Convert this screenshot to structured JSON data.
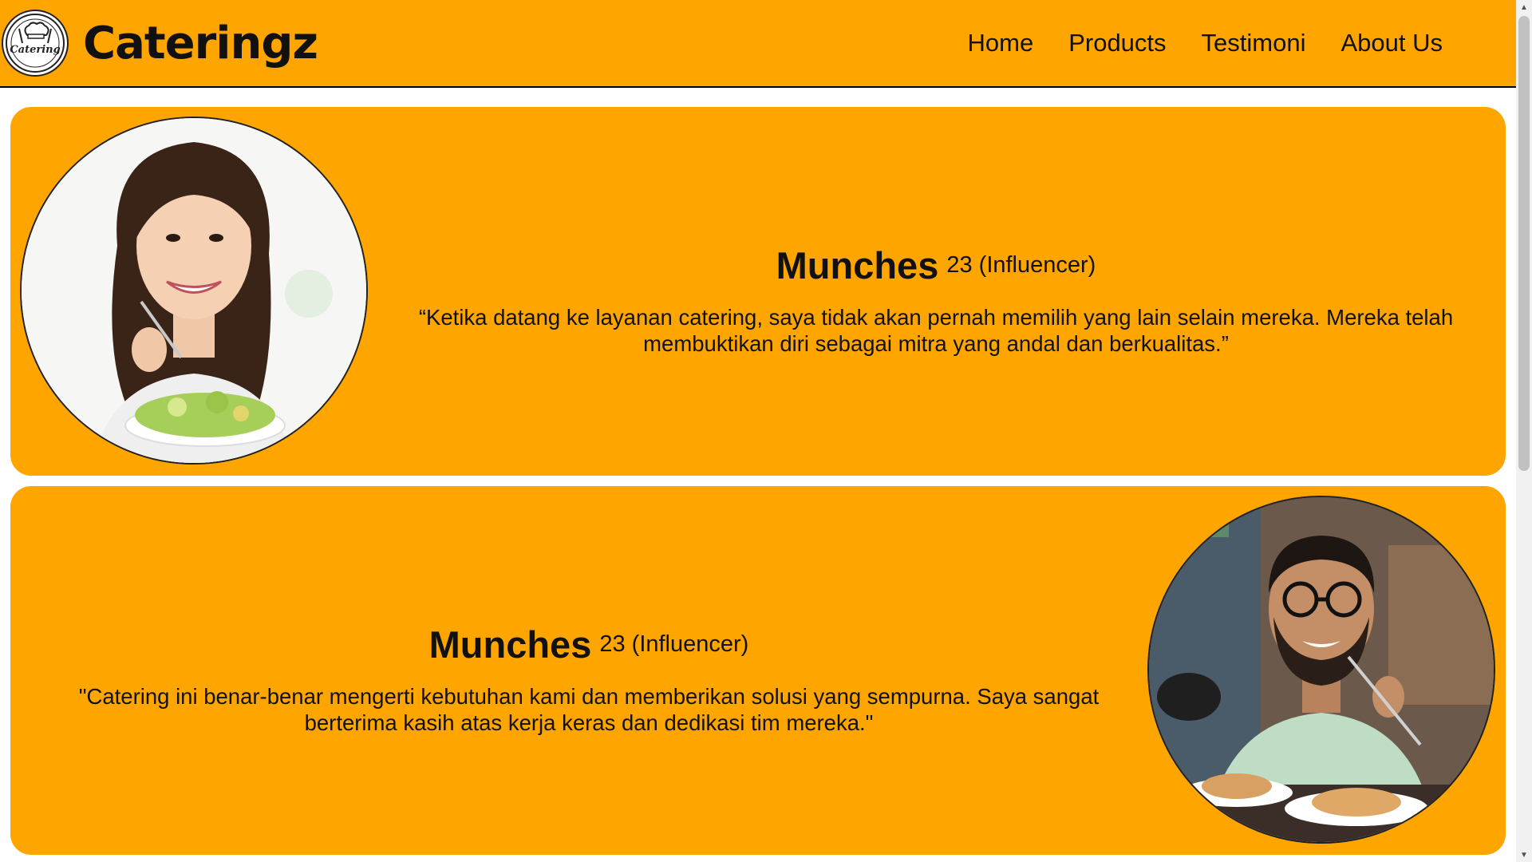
{
  "header": {
    "brand": "Cateringz",
    "logo_text": "Catering",
    "nav": [
      "Home",
      "Products",
      "Testimoni",
      "About Us"
    ]
  },
  "testimonials": [
    {
      "name": "Munches",
      "meta": "23 (Influencer)",
      "quote": "“Ketika datang ke layanan catering, saya tidak akan pernah memilih yang lain selain mereka. Mereka telah membuktikan diri sebagai mitra yang andal dan berkualitas.”"
    },
    {
      "name": "Munches",
      "meta": "23 (Influencer)",
      "quote": "\"Catering ini benar-benar mengerti kebutuhan kami dan memberikan solusi yang sempurna. Saya sangat berterima kasih atas kerja keras dan dedikasi tim mereka.\""
    }
  ],
  "colors": {
    "accent": "#FFA500",
    "text": "#111111"
  }
}
